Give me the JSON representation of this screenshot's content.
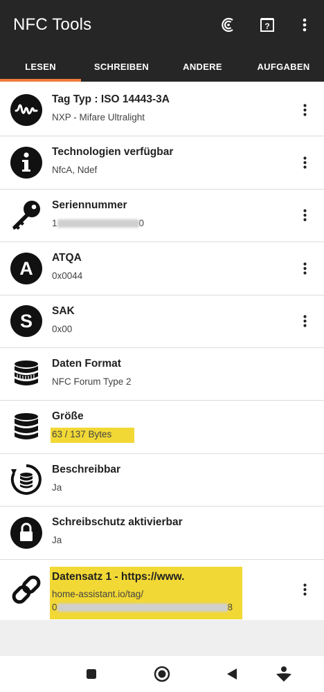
{
  "app": {
    "title": "NFC Tools"
  },
  "appbar_icons": [
    {
      "name": "nfc-scan-icon"
    },
    {
      "name": "help-icon"
    },
    {
      "name": "overflow-menu-icon"
    }
  ],
  "tabs": [
    {
      "label": "LESEN",
      "active": true
    },
    {
      "label": "SCHREIBEN",
      "active": false
    },
    {
      "label": "ANDERE",
      "active": false
    },
    {
      "label": "AUFGABEN",
      "active": false
    }
  ],
  "accent": "#f07a3a",
  "highlight": "#f2d835",
  "rows": [
    {
      "icon": "waveform-icon",
      "title": "Tag Typ : ISO 14443-3A",
      "value": "NXP - Mifare Ultralight",
      "menu": true
    },
    {
      "icon": "info-icon",
      "title": "Technologien verfügbar",
      "value": "NfcA, Ndef",
      "menu": true
    },
    {
      "icon": "key-icon",
      "title": "Seriennummer",
      "value_prefix": "1",
      "value_suffix": "0",
      "menu": true
    },
    {
      "icon": "letter-a-icon",
      "title": "ATQA",
      "value": "0x0044",
      "menu": true
    },
    {
      "icon": "letter-s-icon",
      "title": "SAK",
      "value": "0x00",
      "menu": true
    },
    {
      "icon": "database-stack-icon",
      "title": "Daten Format",
      "value": "NFC Forum Type 2",
      "menu": false
    },
    {
      "icon": "database-icon",
      "title": "Größe",
      "value": "63 / 137 Bytes",
      "menu": false
    },
    {
      "icon": "rewritable-icon",
      "title": "Beschreibbar",
      "value": "Ja",
      "menu": false
    },
    {
      "icon": "lock-icon",
      "title": "Schreibschutz aktivierbar",
      "value": "Ja",
      "menu": false
    },
    {
      "icon": "link-icon",
      "title": "Datensatz 1 - https://www.",
      "value_line1": "home-assistant.io/tag/",
      "value_prefix": "0",
      "value_suffix": "8",
      "menu": true
    }
  ],
  "navbar": [
    {
      "name": "recent-apps-icon"
    },
    {
      "name": "home-icon"
    },
    {
      "name": "back-icon"
    },
    {
      "name": "assistant-icon"
    }
  ]
}
